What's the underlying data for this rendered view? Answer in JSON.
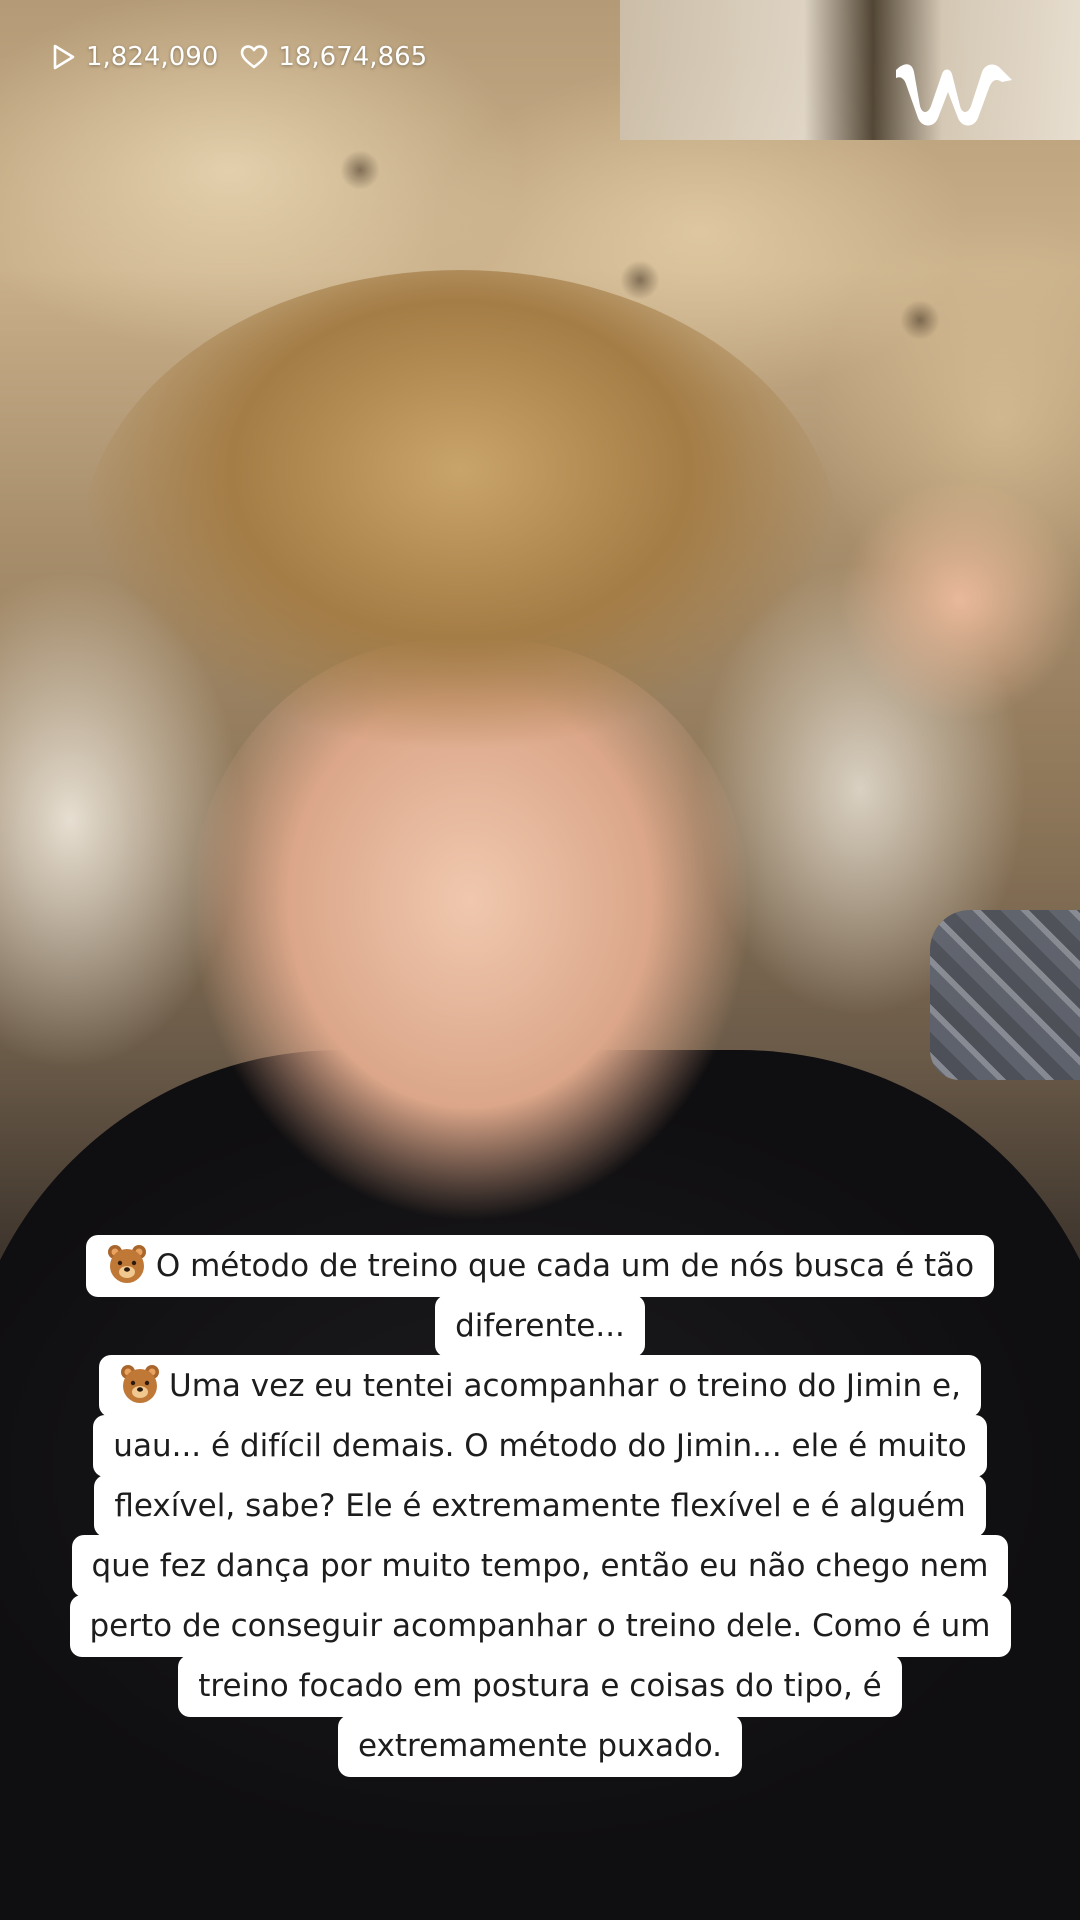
{
  "stats": {
    "views": "1,824,090",
    "likes": "18,674,865"
  },
  "brand": {
    "logo_icon": "weverse-w-logo",
    "logo_color": "#ffffff"
  },
  "captions": {
    "emoji_icon": "bear-face-emoji",
    "lines": [
      "O método de treino que cada um de nós busca é tão",
      "diferente...",
      "Uma vez eu tentei acompanhar o treino do Jimin e,",
      "uau... é difícil demais. O método do Jimin... ele é muito",
      "flexível, sabe? Ele é extremamente flexível e é alguém",
      "que fez dança por muito tempo, então eu não chego nem",
      "perto de conseguir acompanhar o treino dele. Como é um",
      "treino focado em postura e coisas do tipo, é",
      "extremamente puxado."
    ]
  }
}
